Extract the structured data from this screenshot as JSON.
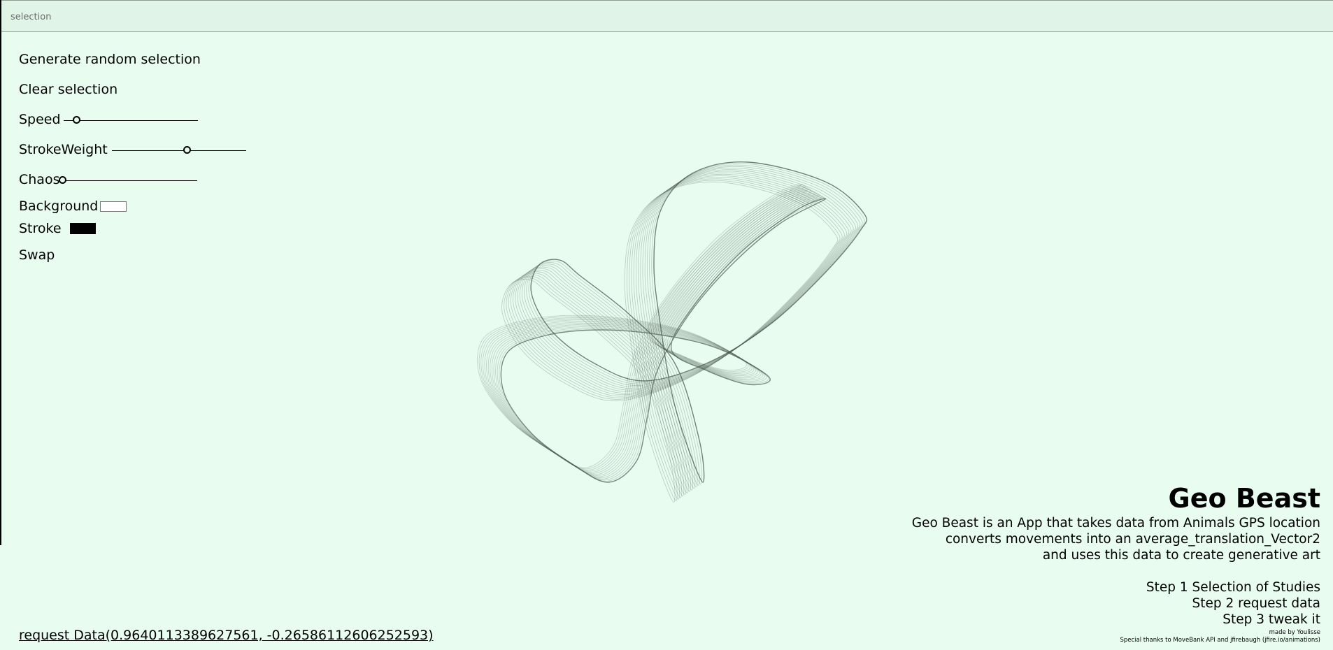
{
  "header": {
    "label": "selection"
  },
  "controls": {
    "generate_label": "Generate random selection",
    "clear_label": "Clear selection",
    "speed": {
      "label": "Speed",
      "value_fraction": 0.1
    },
    "stroke_weight": {
      "label": "StrokeWeight",
      "value_fraction": 0.56
    },
    "chaos": {
      "label": "Chaos",
      "value_fraction": 0.0
    },
    "background": {
      "label": "Background",
      "color": "#ffffff"
    },
    "stroke": {
      "label": "Stroke",
      "color": "#000000"
    },
    "swap_label": "Swap"
  },
  "info": {
    "title": "Geo Beast",
    "desc_line1": "Geo Beast is an App that takes data from Animals GPS location",
    "desc_line2": "converts movements into an average_translation_Vector2",
    "desc_line3": "and uses this data to create generative art",
    "step1": "Step 1 Selection of Studies",
    "step2": "Step 2 request data",
    "step3": "Step 3 tweak it",
    "made_by": "made by Youlisse",
    "thanks": "Special thanks to MoveBank API and jfirebaugh (jfire.io/animations)"
  },
  "request": {
    "label": "request Data(0.9640113389627561, -0.26586112606252593)"
  },
  "colors": {
    "page_background": "#e8fdf0",
    "art_stroke": "#4a5a4e"
  }
}
